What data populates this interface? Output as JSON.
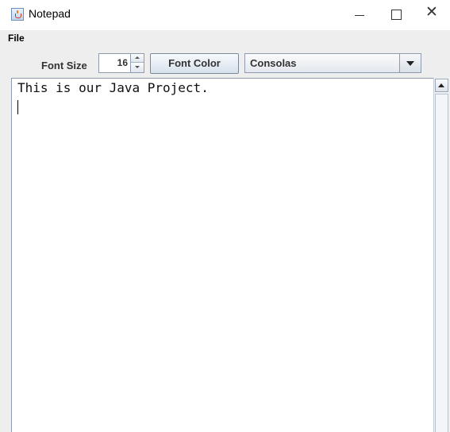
{
  "window": {
    "title": "Notepad"
  },
  "menu": {
    "items": [
      {
        "label": "File"
      }
    ]
  },
  "toolbar": {
    "font_size_label": "Font Size",
    "font_size_value": "16",
    "font_color_label": "Font Color",
    "font_family_selected": "Consolas"
  },
  "editor": {
    "text": "This is our Java Project."
  },
  "colors": {
    "window_bg": "#eeeeee",
    "titlebar_bg": "#ffffff",
    "editor_bg": "#ffffff",
    "button_border": "#7a8a99",
    "text": "#111111"
  }
}
